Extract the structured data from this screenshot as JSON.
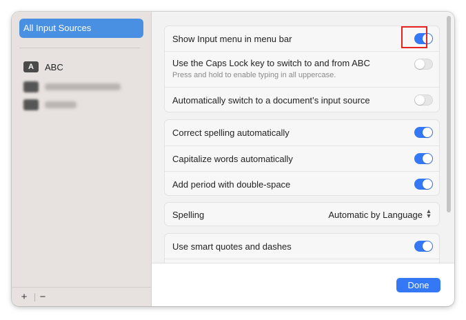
{
  "sidebar": {
    "selected_label": "All Input Sources",
    "sources": [
      {
        "badge": "A",
        "label": "ABC"
      }
    ],
    "add_label": "+",
    "remove_label": "−"
  },
  "groups": {
    "input": {
      "show_menu": {
        "label": "Show Input menu in menu bar",
        "on": true
      },
      "caps_lock": {
        "label": "Use the Caps Lock key to switch to and from ABC",
        "sublabel": "Press and hold to enable typing in all uppercase.",
        "on": false
      },
      "auto_switch": {
        "label": "Automatically switch to a document’s input source",
        "on": false
      }
    },
    "typing": {
      "correct_spelling": {
        "label": "Correct spelling automatically",
        "on": true
      },
      "capitalize": {
        "label": "Capitalize words automatically",
        "on": true
      },
      "period": {
        "label": "Add period with double-space",
        "on": true
      }
    },
    "spelling": {
      "label": "Spelling",
      "value": "Automatic by Language"
    },
    "smart": {
      "quotes": {
        "label": "Use smart quotes and dashes",
        "on": true
      }
    }
  },
  "footer": {
    "done_label": "Done"
  },
  "colors": {
    "accent": "#3478f6",
    "highlight": "#e8221f"
  }
}
